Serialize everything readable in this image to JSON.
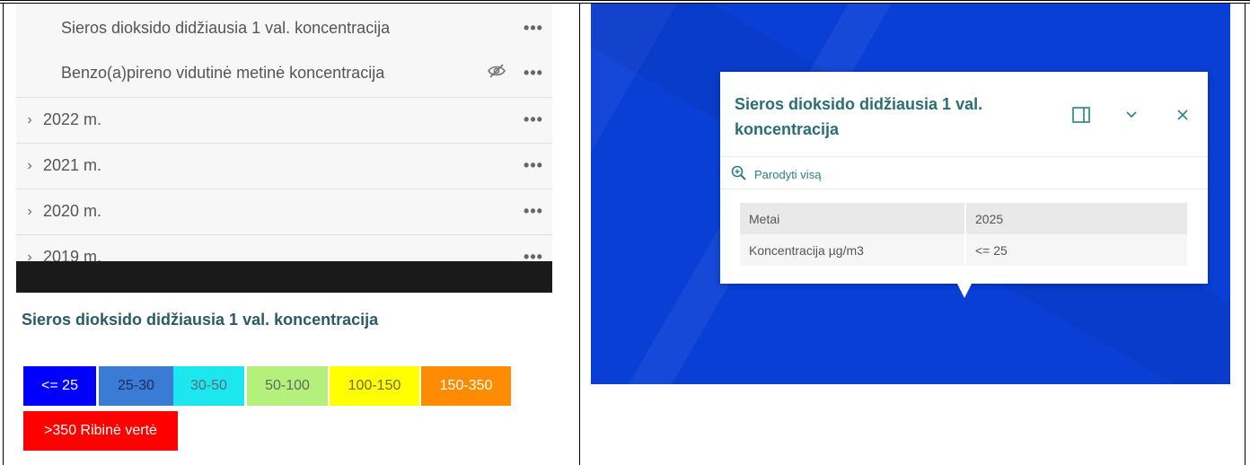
{
  "layers": {
    "sub_items": [
      {
        "label": "Sieros dioksido didžiausia 1 val. koncentracija",
        "hidden": false
      },
      {
        "label": "Benzo(a)pireno vidutinė metinė koncentracija",
        "hidden": true
      }
    ],
    "groups": [
      {
        "label": "2022 m."
      },
      {
        "label": "2021 m."
      },
      {
        "label": "2020 m."
      },
      {
        "label": "2019 m."
      }
    ],
    "more_symbol": "•••",
    "chevron_symbol": "›",
    "hidden_symbol": "⊘"
  },
  "legend": {
    "title": "Sieros dioksido didžiausia 1 val. koncentracija",
    "classes": [
      {
        "label": "<= 25",
        "color": "#0000ff",
        "text_color": "#ffffff"
      },
      {
        "label": "25-30",
        "color": "#3a7bd5",
        "text_color": "#1a2b5c"
      },
      {
        "label": "30-50",
        "color": "#1ce7ee",
        "text_color": "#5b6c75"
      },
      {
        "label": "50-100",
        "color": "#b5f07d",
        "text_color": "#606b5c"
      },
      {
        "label": "100-150",
        "color": "#ffff00",
        "text_color": "#6b6b4e"
      },
      {
        "label": "150-350",
        "color": "#ff8c00",
        "text_color": "#ffffff"
      },
      {
        "label": ">350 Ribinė vertė",
        "color": "#ff0000",
        "text_color": "#ffffff"
      }
    ]
  },
  "popup": {
    "title": "Sieros dioksido didžiausia 1 val. koncentracija",
    "zoom_label": "Parodyti visą",
    "attributes": [
      {
        "key": "Metai",
        "value": "2025"
      },
      {
        "key": "Koncentracija µg/m3",
        "value": "<= 25"
      }
    ]
  },
  "colors": {
    "map_background": "#0a3fd6",
    "accent": "#2a7f86"
  }
}
